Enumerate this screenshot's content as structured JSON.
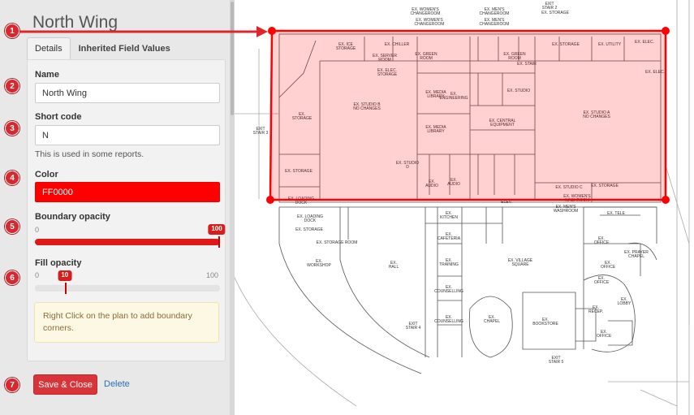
{
  "panel": {
    "title": "North Wing",
    "tabs": [
      {
        "label": "Details",
        "active": true
      },
      {
        "label": "Inherited Field Values",
        "active": false
      }
    ],
    "fields": {
      "name": {
        "label": "Name",
        "value": "North Wing"
      },
      "short_code": {
        "label": "Short code",
        "value": "N",
        "help": "This is used in some reports."
      },
      "color": {
        "label": "Color",
        "value": "FF0000",
        "hex": "#ff0000"
      },
      "boundary_opacity": {
        "label": "Boundary opacity",
        "min": "0",
        "max": "",
        "value": "100",
        "level": 1.0
      },
      "fill_opacity": {
        "label": "Fill opacity",
        "min": "0",
        "max": "100",
        "value": "10",
        "level": 0.1
      }
    },
    "note": "Right Click on the plan to add boundary corners.",
    "save_label": "Save & Close",
    "delete_label": "Delete"
  },
  "markers": [
    "1",
    "2",
    "3",
    "4",
    "5",
    "6",
    "7"
  ],
  "plan": {
    "rooms": [
      {
        "label": "EX. WOMEN'S",
        "sub": "CHANGEROOM"
      },
      {
        "label": "EX. MEN'S",
        "sub": "CHANGEROOM"
      },
      {
        "label": "EX. WOMEN'S",
        "sub": "CHANGEROOM"
      },
      {
        "label": "EX. MEN'S",
        "sub": "CHANGEROOM"
      },
      {
        "label": "EXIT",
        "sub": "STAIR 2"
      },
      {
        "label": "EX. STORAGE",
        "sub": ""
      },
      {
        "label": "EX. ICE",
        "sub": "STORAGE"
      },
      {
        "label": "EX. CHILLER",
        "sub": ""
      },
      {
        "label": "EX. SERVER",
        "sub": "ROOM"
      },
      {
        "label": "EX. GREEN",
        "sub": "ROOM"
      },
      {
        "label": "EX. GREEN",
        "sub": "ROOM"
      },
      {
        "label": "EX. STORAGE",
        "sub": ""
      },
      {
        "label": "EX. UTILITY",
        "sub": ""
      },
      {
        "label": "EX. ELEC.",
        "sub": ""
      },
      {
        "label": "EX. ELEC.",
        "sub": "STORAGE"
      },
      {
        "label": "EX. ELEC.",
        "sub": ""
      },
      {
        "label": "EX. STUDIO B",
        "sub": "NO CHANGES"
      },
      {
        "label": "EX. MEDIA",
        "sub": "LIBRARY"
      },
      {
        "label": "EX.",
        "sub": "ENGINEERING"
      },
      {
        "label": "EX. STUDIO",
        "sub": ""
      },
      {
        "label": "EX. STUDIO A",
        "sub": "NO CHANGES"
      },
      {
        "label": "EX. CENTRAL",
        "sub": "EQUIPMENT"
      },
      {
        "label": "EX. MEDIA",
        "sub": "LIBRARY"
      },
      {
        "label": "EX.",
        "sub": "STORAGE"
      },
      {
        "label": "EX. STORAGE",
        "sub": ""
      },
      {
        "label": "EX. STUDIO",
        "sub": "D"
      },
      {
        "label": "EX.",
        "sub": "AUDIO"
      },
      {
        "label": "EX.",
        "sub": "AUDIO"
      },
      {
        "label": "EX. LOADING",
        "sub": "DOCK"
      },
      {
        "label": "EX. LOADING",
        "sub": "DOCK"
      },
      {
        "label": "EX. STORAGE",
        "sub": ""
      },
      {
        "label": "EX. STORAGE ROOM",
        "sub": ""
      },
      {
        "label": "EX.",
        "sub": "WORKSHOP"
      },
      {
        "label": "EX.",
        "sub": "HALL"
      },
      {
        "label": "EX.",
        "sub": "KITCHEN"
      },
      {
        "label": "EX.",
        "sub": "CAFETERIA"
      },
      {
        "label": "EX.",
        "sub": "TRAINING"
      },
      {
        "label": "EX.",
        "sub": "COUNSELLING"
      },
      {
        "label": "EX.",
        "sub": "COUNSELLING"
      },
      {
        "label": "EX.",
        "sub": "CHAPEL"
      },
      {
        "label": "EX. VILLAGE",
        "sub": "SQUARE"
      },
      {
        "label": "EX.",
        "sub": "BOOKSTORE"
      },
      {
        "label": "EX. STUDIO C",
        "sub": ""
      },
      {
        "label": "EX. STORAGE",
        "sub": ""
      },
      {
        "label": "EX. MEN'S",
        "sub": "WASHROOM"
      },
      {
        "label": "EX. WOMEN'S",
        "sub": "WASHROOM"
      },
      {
        "label": "EX. TELE",
        "sub": ""
      },
      {
        "label": "EX.",
        "sub": "OFFICE"
      },
      {
        "label": "EX. PRAYER",
        "sub": "CHAPEL"
      },
      {
        "label": "EX.",
        "sub": "OFFICE"
      },
      {
        "label": "EX.",
        "sub": "OFFICE"
      },
      {
        "label": "EX.",
        "sub": "LOBBY"
      },
      {
        "label": "EX.",
        "sub": "RECEP."
      },
      {
        "label": "EX.",
        "sub": "OFFICE"
      },
      {
        "label": "EXIT",
        "sub": "STAIR 3"
      },
      {
        "label": "EXIT",
        "sub": "STAIR 4"
      },
      {
        "label": "EXIT",
        "sub": "STAIR 5"
      },
      {
        "label": "ELEV.",
        "sub": ""
      },
      {
        "label": "EX. STAIR",
        "sub": ""
      }
    ]
  },
  "colors": {
    "accent": "#d9272d",
    "boundary": "#ff0000",
    "fill": "rgba(255,0,0,0.18)"
  }
}
